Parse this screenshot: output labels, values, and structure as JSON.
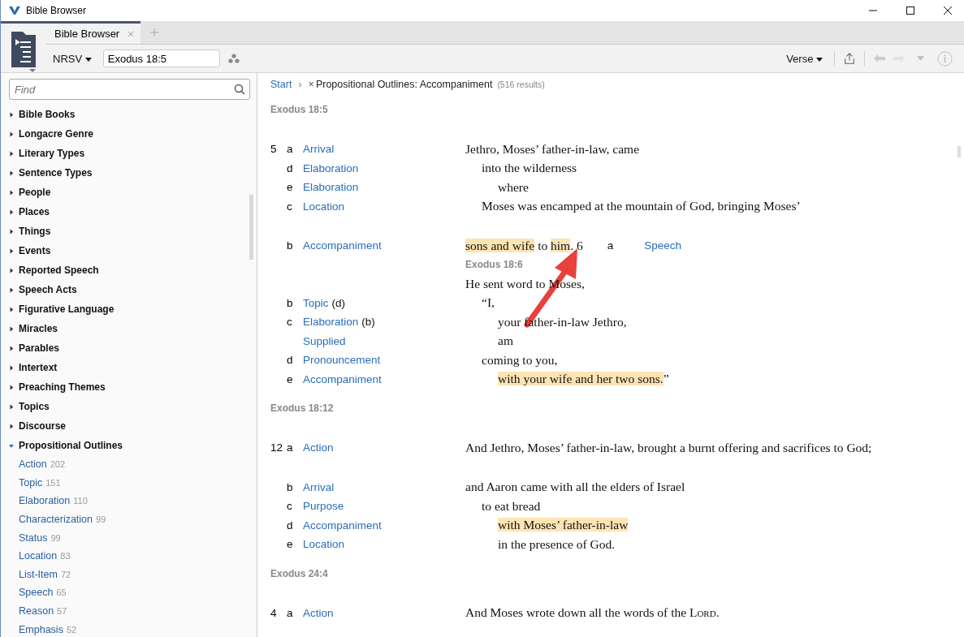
{
  "window": {
    "title": "Bible Browser"
  },
  "tabs": [
    {
      "label": "Bible Browser",
      "selected": true
    }
  ],
  "toolbar": {
    "version": "NRSV",
    "reference": "Exodus 18:5",
    "view": "Verse"
  },
  "sidebar": {
    "search": {
      "placeholder": "Find"
    },
    "items": [
      {
        "label": "Bible Books",
        "expanded": false
      },
      {
        "label": "Longacre Genre",
        "expanded": false
      },
      {
        "label": "Literary Types",
        "expanded": false
      },
      {
        "label": "Sentence Types",
        "expanded": false
      },
      {
        "label": "People",
        "expanded": false
      },
      {
        "label": "Places",
        "expanded": false
      },
      {
        "label": "Things",
        "expanded": false
      },
      {
        "label": "Events",
        "expanded": false
      },
      {
        "label": "Reported Speech",
        "expanded": false
      },
      {
        "label": "Speech Acts",
        "expanded": false
      },
      {
        "label": "Figurative Language",
        "expanded": false
      },
      {
        "label": "Miracles",
        "expanded": false
      },
      {
        "label": "Parables",
        "expanded": false
      },
      {
        "label": "Intertext",
        "expanded": false
      },
      {
        "label": "Preaching Themes",
        "expanded": false
      },
      {
        "label": "Topics",
        "expanded": false
      },
      {
        "label": "Discourse",
        "expanded": false
      },
      {
        "label": "Propositional Outlines",
        "expanded": true,
        "children": [
          {
            "label": "Action",
            "count": "202"
          },
          {
            "label": "Topic",
            "count": "151"
          },
          {
            "label": "Elaboration",
            "count": "110"
          },
          {
            "label": "Characterization",
            "count": "99"
          },
          {
            "label": "Status",
            "count": "99"
          },
          {
            "label": "Location",
            "count": "83"
          },
          {
            "label": "List-Item",
            "count": "72"
          },
          {
            "label": "Speech",
            "count": "65"
          },
          {
            "label": "Reason",
            "count": "57"
          },
          {
            "label": "Emphasis",
            "count": "52"
          }
        ]
      }
    ]
  },
  "breadcrumb": {
    "start": "Start",
    "separator": "›",
    "remove": "×",
    "query": "Propositional Outlines: Accompaniment",
    "results": "(516 results)"
  },
  "sections": [
    {
      "reference": "Exodus 18:5",
      "rows": [
        {
          "kind": "line",
          "verse": "5",
          "letter": "a",
          "label": "Arrival",
          "segments": [
            {
              "text": "Jethro, Moses’ father-in-law, came",
              "highlighted": false
            }
          ],
          "children": [
            {
              "kind": "line",
              "letter": "d",
              "label": "Elaboration",
              "segments": [
                {
                  "text": "into the wilderness",
                  "highlighted": false
                }
              ],
              "children": [
                {
                  "kind": "line",
                  "letter": "e",
                  "label": "Elaboration",
                  "segments": [
                    {
                      "text": "where",
                      "highlighted": false
                    }
                  ]
                }
              ]
            },
            {
              "kind": "line",
              "letter": "c",
              "label": "Location",
              "segments": [
                {
                  "text": "Moses was encamped at the mountain of God, bringing Moses’",
                  "highlighted": false
                }
              ]
            }
          ]
        },
        {
          "kind": "spaced-line",
          "letter": "b",
          "label": "Accompaniment",
          "segments": [
            {
              "text": "sons and wife",
              "highlighted": true
            },
            {
              "text": " to ",
              "highlighted": false
            },
            {
              "text": "him",
              "highlighted": true
            },
            {
              "text": ".",
              "highlighted": false
            }
          ],
          "trail": {
            "verse": "6",
            "letter": "a",
            "label": "Speech"
          }
        },
        {
          "kind": "reference",
          "text": "Exodus 18:6"
        },
        {
          "kind": "line",
          "segments": [
            {
              "text": "He sent word to Moses,",
              "highlighted": false
            }
          ],
          "children": [
            {
              "kind": "line",
              "letter": "b",
              "label": "Topic",
              "note": "(d)",
              "segments": [
                {
                  "text": "“I,",
                  "highlighted": false
                }
              ],
              "children": [
                {
                  "kind": "line",
                  "letter": "c",
                  "label": "Elaboration",
                  "note": "(b)",
                  "segments": [
                    {
                      "text": "your father-in-law Jethro,",
                      "highlighted": false
                    }
                  ]
                },
                {
                  "kind": "line",
                  "label": "Supplied",
                  "segments": [
                    {
                      "text": "am",
                      "highlighted": false
                    }
                  ]
                }
              ]
            },
            {
              "kind": "line",
              "letter": "d",
              "label": "Pronouncement",
              "segments": [
                {
                  "text": "coming to you,",
                  "highlighted": false
                }
              ],
              "children": [
                {
                  "kind": "line",
                  "letter": "e",
                  "label": "Accompaniment",
                  "segments": [
                    {
                      "text": "with your wife and her two sons.",
                      "highlighted": true
                    },
                    {
                      "text": "”",
                      "highlighted": false
                    }
                  ]
                }
              ]
            }
          ]
        }
      ]
    },
    {
      "reference": "Exodus 18:12",
      "rows": [
        {
          "kind": "line",
          "verse": "12",
          "letter": "a",
          "label": "Action",
          "segments": [
            {
              "text": "And Jethro, Moses’ father-in-law, brought a burnt offering and sacrifices to God;",
              "highlighted": false
            }
          ]
        },
        {
          "kind": "spaced-line",
          "letter": "b",
          "label": "Arrival",
          "segments": [
            {
              "text": "and Aaron came with all the elders of Israel",
              "highlighted": false
            }
          ],
          "children": [
            {
              "kind": "line",
              "letter": "c",
              "label": "Purpose",
              "segments": [
                {
                  "text": "to eat bread",
                  "highlighted": false
                }
              ],
              "children": [
                {
                  "kind": "line",
                  "letter": "d",
                  "label": "Accompaniment",
                  "segments": [
                    {
                      "text": "with Moses’ father-in-law",
                      "highlighted": true
                    }
                  ]
                },
                {
                  "kind": "line",
                  "letter": "e",
                  "label": "Location",
                  "segments": [
                    {
                      "text": "in the presence of God.",
                      "highlighted": false
                    }
                  ]
                }
              ]
            }
          ]
        }
      ]
    },
    {
      "reference": "Exodus 24:4",
      "rows": [
        {
          "kind": "line",
          "verse": "4",
          "letter": "a",
          "label": "Action",
          "segments": [
            {
              "text": "And Moses wrote down all the words of the ",
              "highlighted": false
            },
            {
              "text": "Lord",
              "highlighted": false,
              "small_caps": true
            },
            {
              "text": ".",
              "highlighted": false
            }
          ]
        }
      ]
    }
  ]
}
